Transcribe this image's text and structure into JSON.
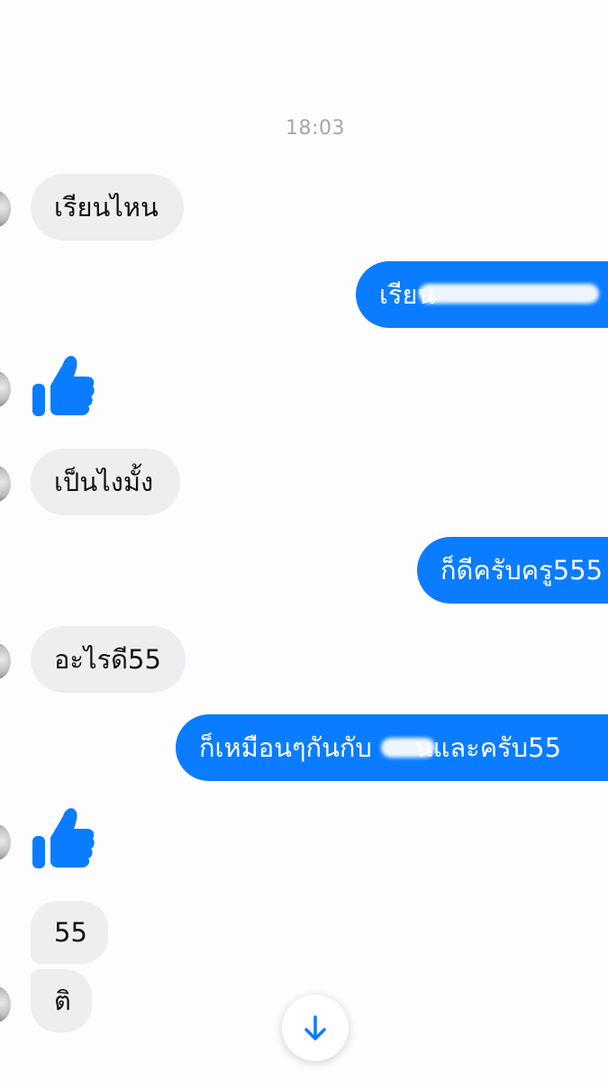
{
  "conversation": {
    "timestamp": "18:03",
    "messages": [
      {
        "id": "m1",
        "side": "incoming",
        "text": "เรียนไหน"
      },
      {
        "id": "m2",
        "side": "outgoing",
        "text": "เรียน"
      },
      {
        "id": "m3",
        "side": "incoming",
        "type": "thumbs-up",
        "icon": "thumbs-up-icon"
      },
      {
        "id": "m4",
        "side": "incoming",
        "text": "เป็นไงมั้ง"
      },
      {
        "id": "m5",
        "side": "outgoing",
        "text": "ก็ดีครับครู555"
      },
      {
        "id": "m6",
        "side": "incoming",
        "text": "อะไรดี55"
      },
      {
        "id": "m7",
        "side": "outgoing",
        "text": "ก็เหมือนๆกันกับ",
        "text_after": "นและครับ55"
      },
      {
        "id": "m8",
        "side": "incoming",
        "type": "thumbs-up",
        "icon": "thumbs-up-icon"
      },
      {
        "id": "m9",
        "side": "incoming",
        "text": "55"
      },
      {
        "id": "m10",
        "side": "incoming",
        "text": "ติ"
      }
    ]
  },
  "scroll_button": {
    "icon": "arrow-down-icon"
  },
  "colors": {
    "outgoing": "#0a7cff",
    "incoming": "#eeedf0",
    "timestamp": "#a7a7a7"
  }
}
